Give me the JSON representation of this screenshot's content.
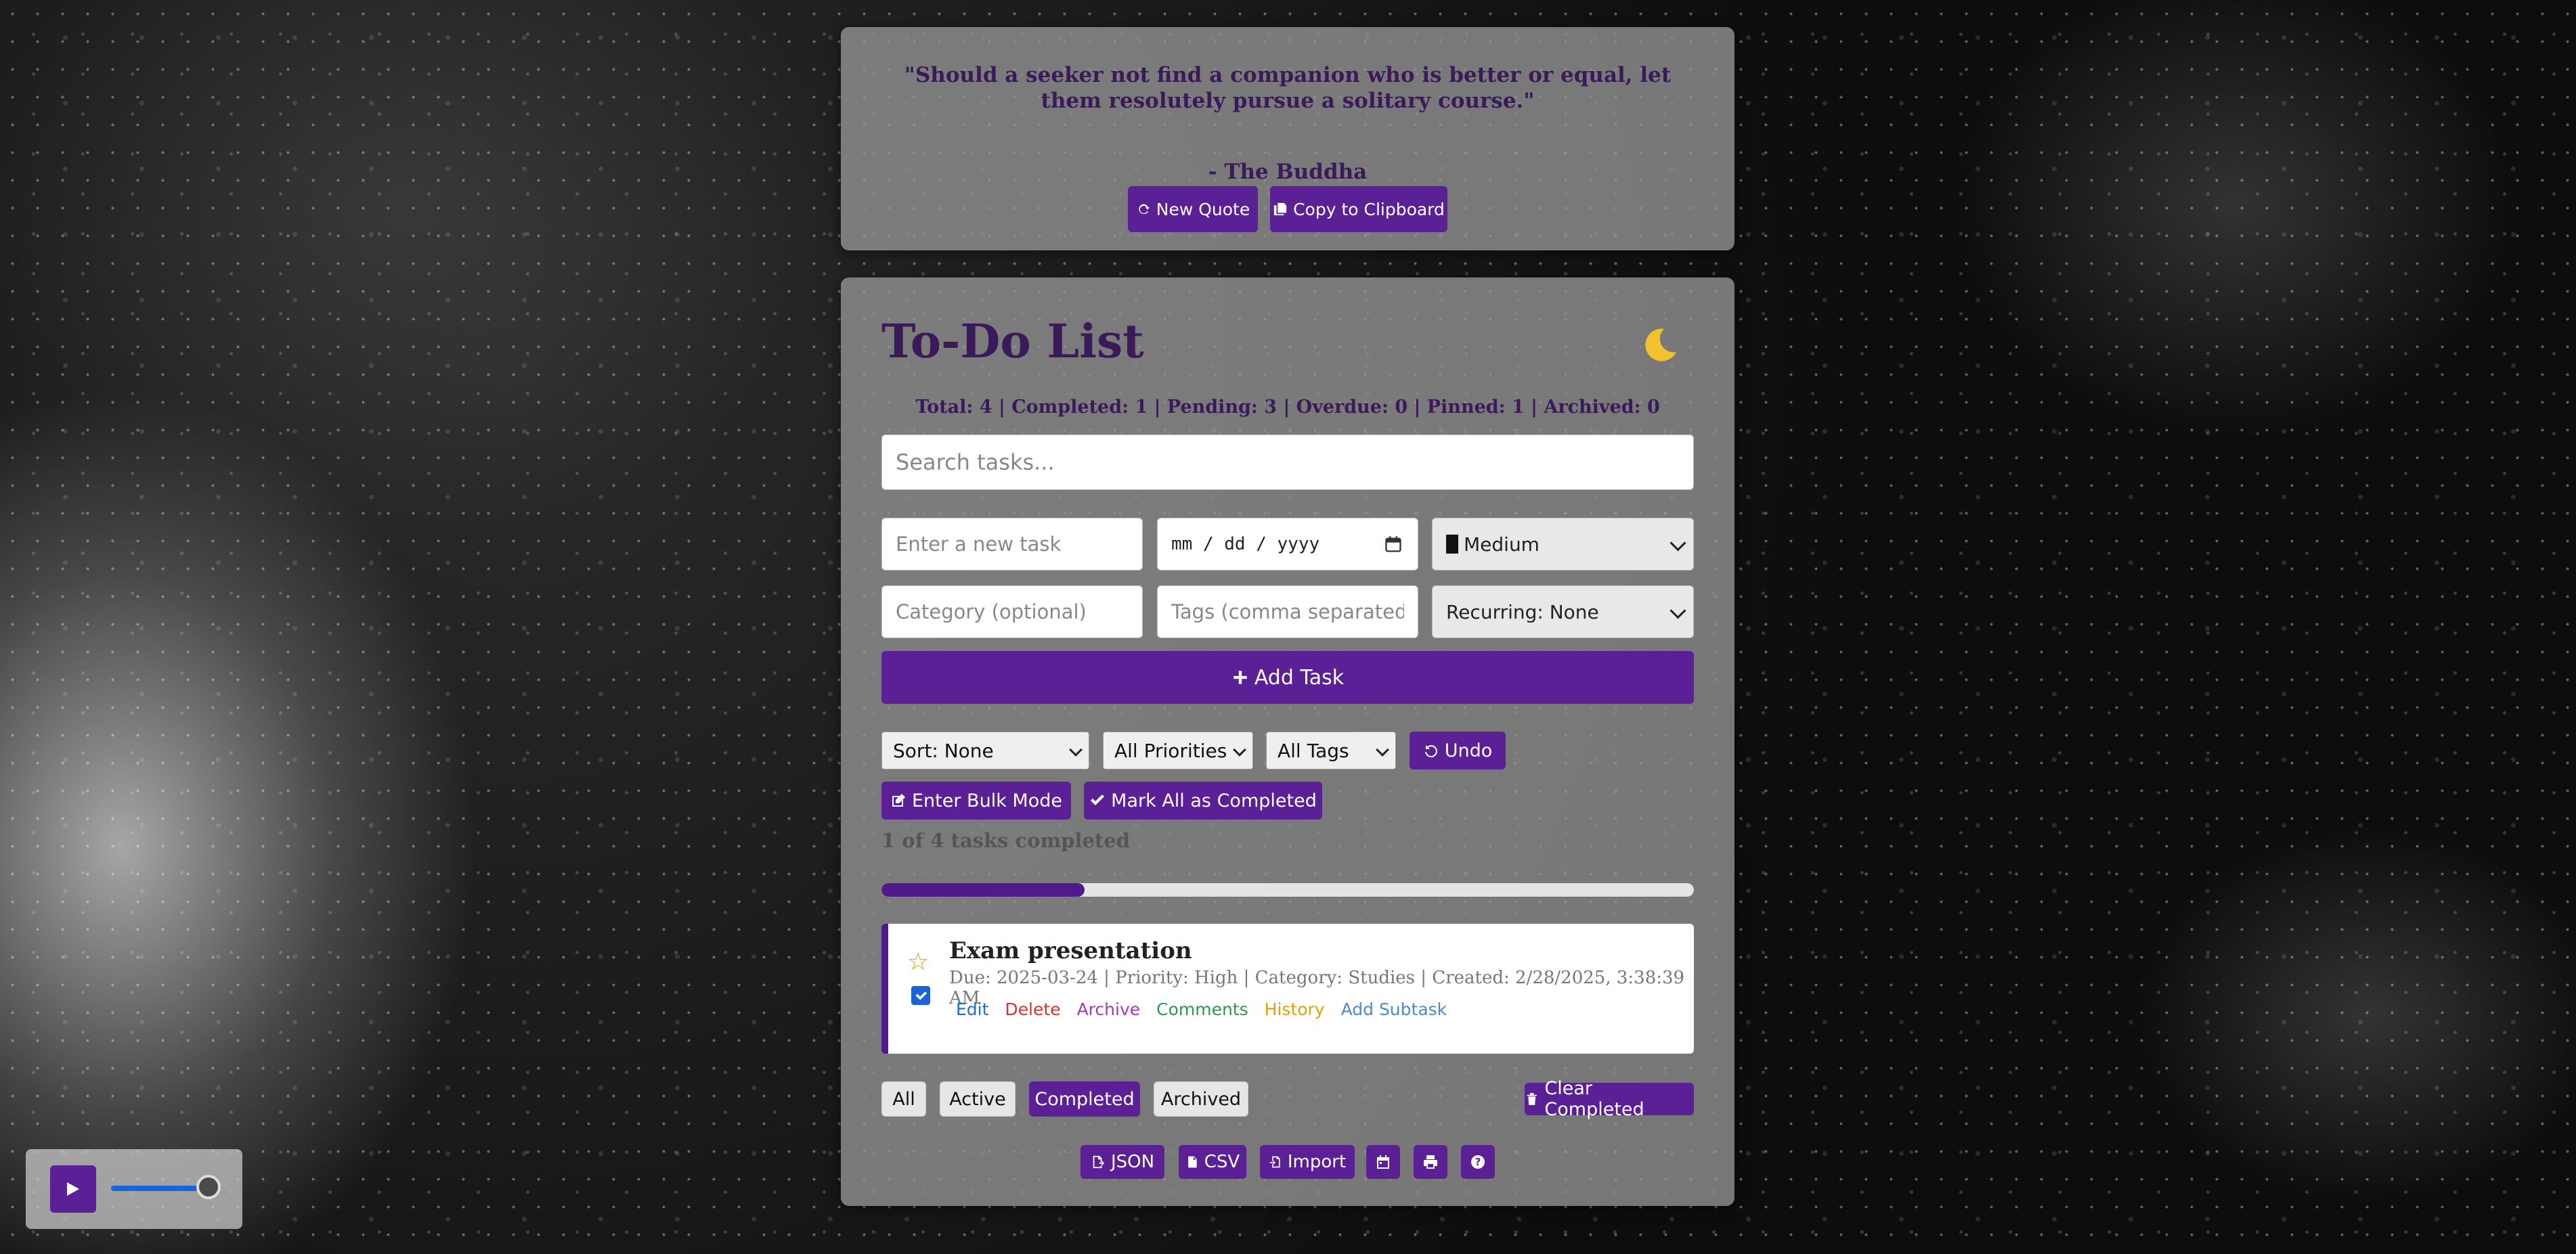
{
  "quote": {
    "text": "\"Should a seeker not find a companion who is better or equal, let them resolutely pursue a solitary course.\"",
    "author": "- The Buddha",
    "new_quote_label": "New Quote",
    "copy_label": "Copy to Clipboard"
  },
  "todo": {
    "title": "To-Do List",
    "stats": "Total: 4 | Completed: 1 | Pending: 3 | Overdue: 0 | Pinned: 1 | Archived: 0",
    "search_placeholder": "Search tasks...",
    "new_task_placeholder": "Enter a new task",
    "date_placeholder": "mm / dd / yyyy",
    "priority_value": "Medium",
    "category_placeholder": "Category (optional)",
    "tags_placeholder": "Tags (comma separated)",
    "recurring_value": "Recurring: None",
    "add_task_label": "Add Task",
    "sort_value": "Sort: None",
    "priority_filter_value": "All Priorities",
    "tags_filter_value": "All Tags",
    "undo_label": "Undo",
    "bulk_mode_label": "Enter Bulk Mode",
    "mark_all_label": "Mark All as Completed",
    "progress_text": "1 of 4 tasks completed",
    "progress_fraction": 0.25
  },
  "task": {
    "title": "Exam presentation",
    "meta": "Due: 2025-03-24 | Priority: High | Category: Studies | Created: 2/28/2025, 3:38:39 AM",
    "completed": true,
    "actions": [
      {
        "label": "Edit",
        "color": "#1a6fc9"
      },
      {
        "label": "Delete",
        "color": "#d93030"
      },
      {
        "label": "Archive",
        "color": "#9b3bb5"
      },
      {
        "label": "Comments",
        "color": "#2a9a4a"
      },
      {
        "label": "History",
        "color": "#e0a000"
      },
      {
        "label": "Add Subtask",
        "color": "#4a8ac9"
      }
    ]
  },
  "filters": {
    "all": "All",
    "active": "Active",
    "completed": "Completed",
    "archived": "Archived",
    "selected": "Completed",
    "clear_completed": "Clear Completed"
  },
  "footer": {
    "json_label": "JSON",
    "csv_label": "CSV",
    "import_label": "Import"
  },
  "colors": {
    "accent": "#5b1f96",
    "title": "#3b1a5a"
  },
  "audio": {
    "volume": 0.85
  }
}
